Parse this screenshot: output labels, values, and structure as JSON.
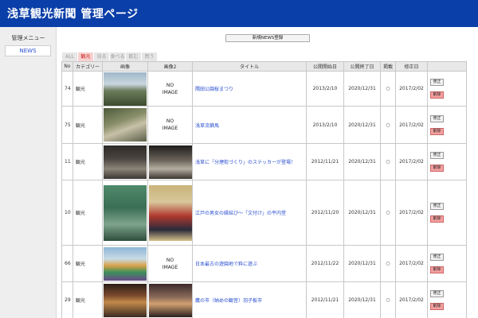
{
  "header": {
    "title": "浅草観光新聞 管理ページ"
  },
  "sidebar": {
    "heading": "管理メニュー",
    "items": [
      {
        "label": "NEWS"
      }
    ]
  },
  "register_button": "新規NEWS登録",
  "tabs": [
    {
      "label": "ALL",
      "active": false
    },
    {
      "label": "観光",
      "active": true
    },
    {
      "label": "泊る",
      "active": false
    },
    {
      "label": "食べる",
      "active": false
    },
    {
      "label": "飲む",
      "active": false
    },
    {
      "label": "買う",
      "active": false
    }
  ],
  "table": {
    "headers": [
      "No",
      "カテゴリー",
      "画像",
      "画像2",
      "タイトル",
      "公開開始日",
      "公開終了日",
      "掲載",
      "修正日",
      ""
    ],
    "edit_label": "修正",
    "delete_label": "削除",
    "rows": [
      {
        "no": "74",
        "category": "観光",
        "image2": "NO\nIMAGE",
        "title": "隅田公園桜まつり",
        "start": "2013/2/10",
        "end": "2020/12/31",
        "published": "○",
        "modified": "2017/2/02"
      },
      {
        "no": "75",
        "category": "観光",
        "image2": "NO\nIMAGE",
        "title": "浅草流鏑馬",
        "start": "2013/2/10",
        "end": "2020/12/31",
        "published": "○",
        "modified": "2017/2/02"
      },
      {
        "no": "11",
        "category": "観光",
        "image2": "",
        "title": "浅草に「分煙街づくり」のステッカーが登場！",
        "start": "2012/11/21",
        "end": "2020/12/31",
        "published": "○",
        "modified": "2017/2/02"
      },
      {
        "no": "10",
        "category": "観光",
        "image2": "",
        "title": "江戸の男女の縁結び～「文付け」の平内堂",
        "start": "2012/11/20",
        "end": "2020/12/31",
        "published": "○",
        "modified": "2017/2/02"
      },
      {
        "no": "66",
        "category": "観光",
        "image2": "NO\nIMAGE",
        "title": "日本最古の遊園地で粋に遊ぶ",
        "start": "2012/11/22",
        "end": "2020/12/31",
        "published": "○",
        "modified": "2017/2/02"
      },
      {
        "no": "29",
        "category": "観光",
        "image2": "",
        "title": "鷹の市（納めの観音）羽子板市",
        "start": "2012/11/21",
        "end": "2020/12/31",
        "published": "○",
        "modified": "2017/2/02"
      }
    ]
  }
}
